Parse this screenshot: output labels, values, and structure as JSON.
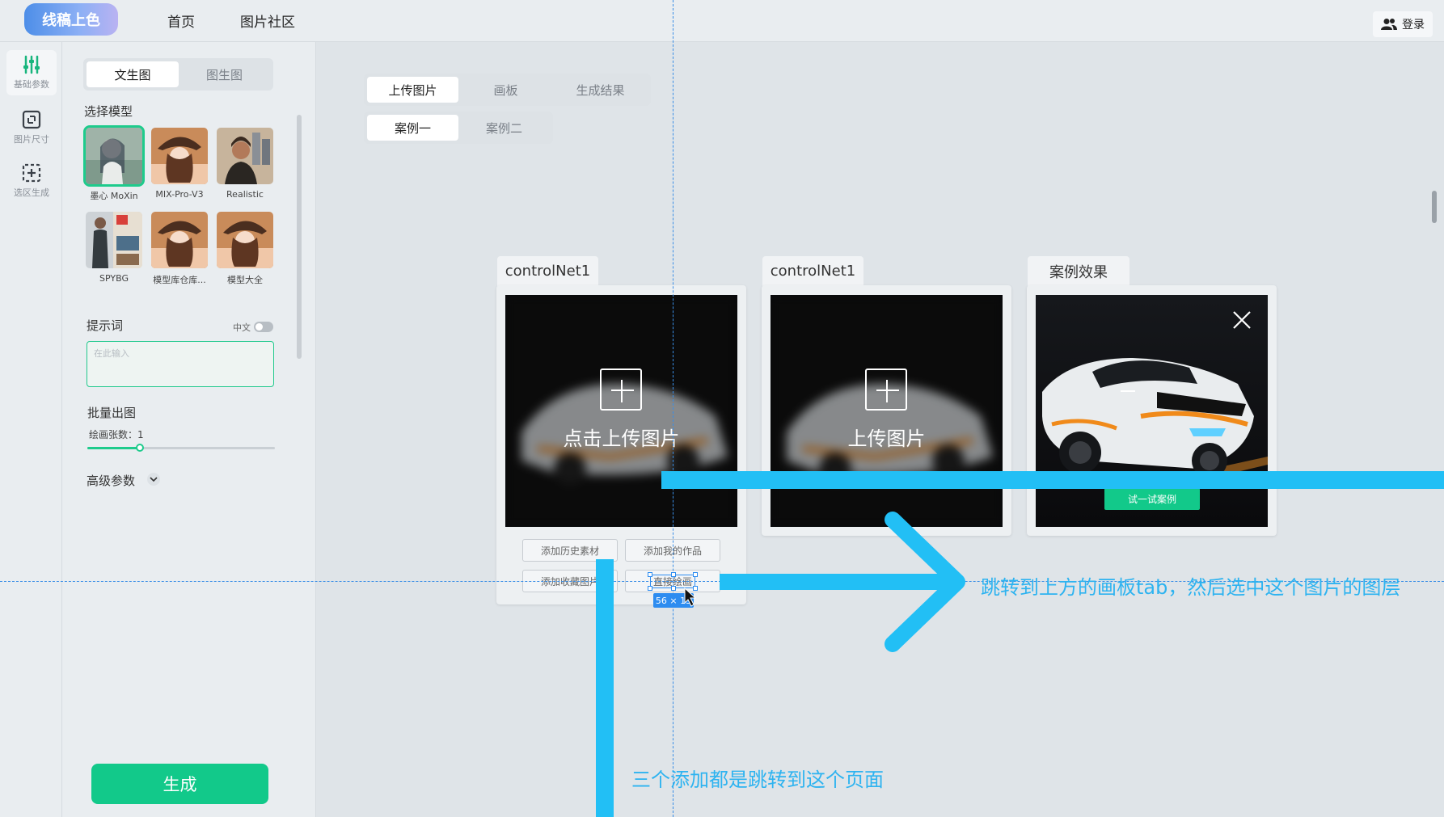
{
  "header": {
    "logo": "线稿上色",
    "nav": [
      "首页",
      "图片社区"
    ],
    "login": "登录"
  },
  "sidebar": {
    "items": [
      {
        "label": "基础参数",
        "icon": "sliders-icon"
      },
      {
        "label": "图片尺寸",
        "icon": "resize-icon"
      },
      {
        "label": "选区生成",
        "icon": "selection-add-icon"
      }
    ]
  },
  "params": {
    "mode_tabs": [
      "文生图",
      "图生图"
    ],
    "select_model": "选择模型",
    "models": [
      "墨心 MoXin",
      "MIX-Pro-V3",
      "Realistic",
      "SPYBG",
      "模型库仓库...",
      "模型大全"
    ],
    "prompt_label": "提示词",
    "cn_toggle": "中文",
    "prompt_placeholder": "在此输入",
    "batch_label": "批量出图",
    "count_label": "绘画张数：",
    "count_value": "1",
    "count_fraction": 0.28,
    "advanced": "高级参数",
    "generate": "生成"
  },
  "canvas": {
    "top_tabs": [
      "上传图片",
      "画板",
      "生成结果"
    ],
    "case_tabs": [
      "案例一",
      "案例二"
    ],
    "card1_title": "controlNet1",
    "card1_upload": "点击上传图片",
    "card2_title": "controlNet1",
    "card2_upload": "上传图片",
    "card3_title": "案例效果",
    "try_case": "试一试案例",
    "buttons": [
      "添加历史素材",
      "添加我的作品",
      "添加收藏图片",
      "直接绘画"
    ]
  },
  "annotations": {
    "size_badge": "56 × 15",
    "right_note": "跳转到上方的画板tab，然后选中这个图片的图层",
    "bottom_note": "三个添加都是跳转到这个页面",
    "color": "#22bff5"
  }
}
